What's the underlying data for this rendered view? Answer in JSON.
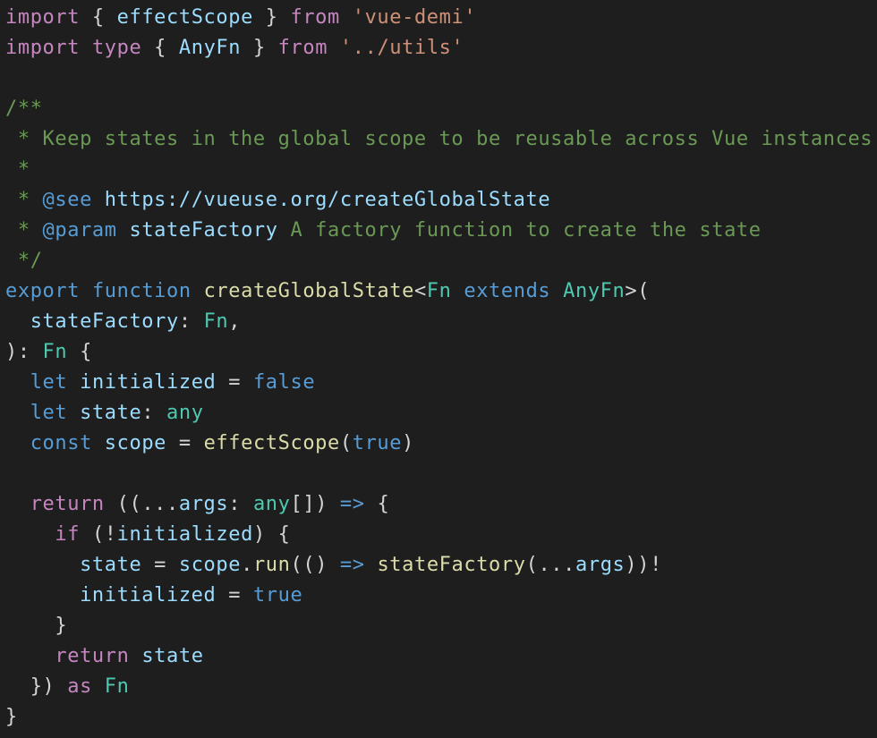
{
  "editor": {
    "language": "typescript",
    "background": "#1e1e1e",
    "colors": {
      "keyword": "#c586c0",
      "storage": "#569cd6",
      "type": "#4ec9b0",
      "function": "#dcdcaa",
      "variable": "#9cdcfe",
      "string": "#ce9178",
      "comment": "#6a9955",
      "punctuation": "#d4d4d4"
    },
    "lines": [
      [
        [
          "keyword",
          "import"
        ],
        [
          "punct",
          " { "
        ],
        [
          "var",
          "effectScope"
        ],
        [
          "punct",
          " } "
        ],
        [
          "keyword",
          "from"
        ],
        [
          "punct",
          " "
        ],
        [
          "string",
          "'vue-demi'"
        ]
      ],
      [
        [
          "keyword",
          "import"
        ],
        [
          "punct",
          " "
        ],
        [
          "keyword",
          "type"
        ],
        [
          "punct",
          " { "
        ],
        [
          "var",
          "AnyFn"
        ],
        [
          "punct",
          " } "
        ],
        [
          "keyword",
          "from"
        ],
        [
          "punct",
          " "
        ],
        [
          "string",
          "'../utils'"
        ]
      ],
      [],
      [
        [
          "comment",
          "/**"
        ]
      ],
      [
        [
          "comment",
          " * Keep states in the global scope to be reusable across Vue instances."
        ]
      ],
      [
        [
          "comment",
          " *"
        ]
      ],
      [
        [
          "comment",
          " * "
        ],
        [
          "doctag",
          "@see"
        ],
        [
          "punct",
          " "
        ],
        [
          "docbold",
          "https://vueuse.org/createGlobalState"
        ]
      ],
      [
        [
          "comment",
          " * "
        ],
        [
          "doctag",
          "@param"
        ],
        [
          "punct",
          " "
        ],
        [
          "docbold",
          "stateFactory"
        ],
        [
          "comment",
          " A factory function to create the state"
        ]
      ],
      [
        [
          "comment",
          " */"
        ]
      ],
      [
        [
          "storage",
          "export"
        ],
        [
          "punct",
          " "
        ],
        [
          "storage",
          "function"
        ],
        [
          "punct",
          " "
        ],
        [
          "func",
          "createGlobalState"
        ],
        [
          "punct",
          "<"
        ],
        [
          "type",
          "Fn"
        ],
        [
          "punct",
          " "
        ],
        [
          "storage",
          "extends"
        ],
        [
          "punct",
          " "
        ],
        [
          "type",
          "AnyFn"
        ],
        [
          "punct",
          ">("
        ]
      ],
      [
        [
          "punct",
          "  "
        ],
        [
          "param",
          "stateFactory"
        ],
        [
          "punct",
          ": "
        ],
        [
          "type",
          "Fn"
        ],
        [
          "punct",
          ","
        ]
      ],
      [
        [
          "punct",
          "): "
        ],
        [
          "type",
          "Fn"
        ],
        [
          "punct",
          " {"
        ]
      ],
      [
        [
          "punct",
          "  "
        ],
        [
          "storage",
          "let"
        ],
        [
          "punct",
          " "
        ],
        [
          "var",
          "initialized"
        ],
        [
          "punct",
          " = "
        ],
        [
          "bool",
          "false"
        ]
      ],
      [
        [
          "punct",
          "  "
        ],
        [
          "storage",
          "let"
        ],
        [
          "punct",
          " "
        ],
        [
          "var",
          "state"
        ],
        [
          "punct",
          ": "
        ],
        [
          "type",
          "any"
        ]
      ],
      [
        [
          "punct",
          "  "
        ],
        [
          "storage",
          "const"
        ],
        [
          "punct",
          " "
        ],
        [
          "var",
          "scope"
        ],
        [
          "punct",
          " = "
        ],
        [
          "func",
          "effectScope"
        ],
        [
          "punct",
          "("
        ],
        [
          "bool",
          "true"
        ],
        [
          "punct",
          ")"
        ]
      ],
      [],
      [
        [
          "punct",
          "  "
        ],
        [
          "keyword",
          "return"
        ],
        [
          "punct",
          " ((..."
        ],
        [
          "param",
          "args"
        ],
        [
          "punct",
          ": "
        ],
        [
          "type",
          "any"
        ],
        [
          "punct",
          "[]) "
        ],
        [
          "storage",
          "=>"
        ],
        [
          "punct",
          " {"
        ]
      ],
      [
        [
          "punct",
          "    "
        ],
        [
          "keyword",
          "if"
        ],
        [
          "punct",
          " (!"
        ],
        [
          "var",
          "initialized"
        ],
        [
          "punct",
          ") {"
        ]
      ],
      [
        [
          "punct",
          "      "
        ],
        [
          "var",
          "state"
        ],
        [
          "punct",
          " = "
        ],
        [
          "var",
          "scope"
        ],
        [
          "punct",
          "."
        ],
        [
          "func",
          "run"
        ],
        [
          "punct",
          "(() "
        ],
        [
          "storage",
          "=>"
        ],
        [
          "punct",
          " "
        ],
        [
          "func",
          "stateFactory"
        ],
        [
          "punct",
          "(..."
        ],
        [
          "var",
          "args"
        ],
        [
          "punct",
          "))!"
        ]
      ],
      [
        [
          "punct",
          "      "
        ],
        [
          "var",
          "initialized"
        ],
        [
          "punct",
          " = "
        ],
        [
          "bool",
          "true"
        ]
      ],
      [
        [
          "punct",
          "    }"
        ]
      ],
      [
        [
          "punct",
          "    "
        ],
        [
          "keyword",
          "return"
        ],
        [
          "punct",
          " "
        ],
        [
          "var",
          "state"
        ]
      ],
      [
        [
          "punct",
          "  }) "
        ],
        [
          "keyword",
          "as"
        ],
        [
          "punct",
          " "
        ],
        [
          "type",
          "Fn"
        ]
      ],
      [
        [
          "punct",
          "}"
        ]
      ]
    ]
  }
}
